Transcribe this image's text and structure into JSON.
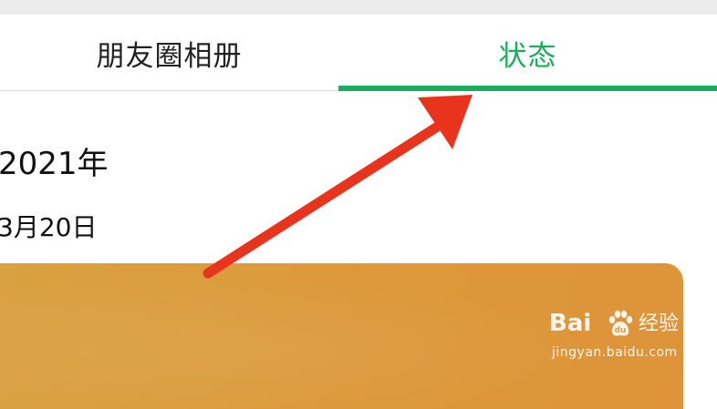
{
  "tabs": [
    {
      "label": "朋友圈相册",
      "active": false
    },
    {
      "label": "状态",
      "active": true
    }
  ],
  "timeline": {
    "year": "2021年",
    "date": "3月20日"
  },
  "watermark": {
    "logo_text": "Bai",
    "name": "经验",
    "url": "jingyan.baidu.com"
  },
  "colors": {
    "accent": "#1aad5b",
    "arrow": "#e8341c",
    "card": "#dc9a3c"
  },
  "icons": {
    "arrow": "red-annotation-arrow-icon",
    "paw": "baidu-paw-icon"
  }
}
